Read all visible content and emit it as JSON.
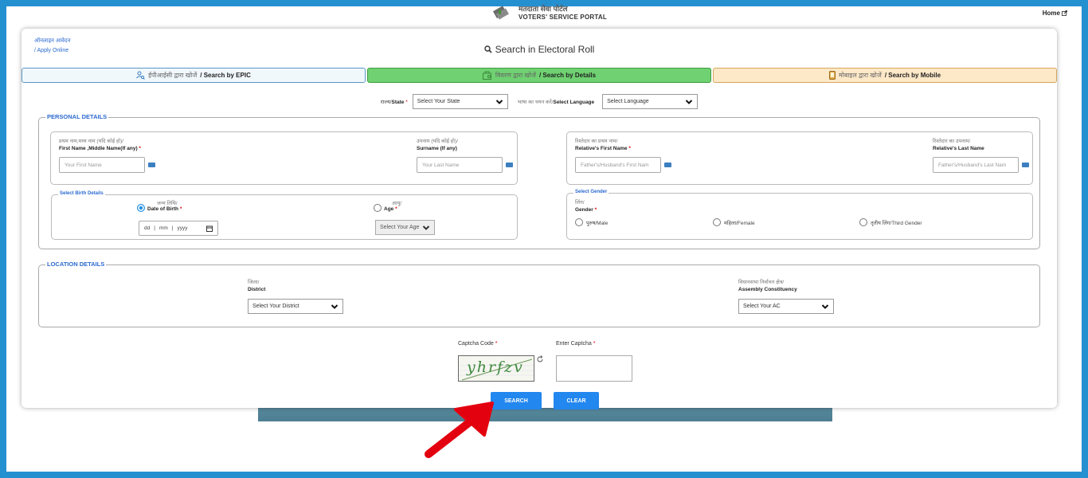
{
  "header": {
    "portal_name_hi": "मतदाता सेवा पोर्टल",
    "portal_name_en": "VOTERS' SERVICE PORTAL",
    "home_label": "Home"
  },
  "card": {
    "apply_online_hi": "ऑनलाइन आवेदन",
    "apply_online_en": "/ Apply Online",
    "title": "Search in Electoral Roll"
  },
  "tabs": [
    {
      "hi": "ईपीआईसी द्वारा खोजें",
      "en": "/ Search by EPIC",
      "icon": "user-search-icon",
      "active": false
    },
    {
      "hi": "विवरण द्वारा खोजें",
      "en": "/ Search by Details",
      "icon": "details-icon",
      "active": true
    },
    {
      "hi": "मोबाइल द्वारा खोजें",
      "en": "/ Search by Mobile",
      "icon": "mobile-icon",
      "active": false
    }
  ],
  "state": {
    "label_hi": "राज्य/",
    "label_en": "State",
    "value": "Select Your State"
  },
  "language": {
    "label_hi": "भाषा का चयन करें/",
    "label_en": "Select Language",
    "value": "Select Language"
  },
  "personal": {
    "legend": "PERSONAL DETAILS",
    "first_name": {
      "label_hi": "प्रथम नाम,मध्य नाम (यदि कोई हो)/",
      "label_en": "First Name ,Middle Name(If any)",
      "placeholder": "Your First Name"
    },
    "surname": {
      "label_hi": "उपनाम (यदि कोई हो)/",
      "label_en": "Surname (If any)",
      "placeholder": "Your Last Name"
    },
    "relative_first": {
      "label_hi": "रिश्तेदार का प्रथम नाम/",
      "label_en": "Relative's First Name",
      "placeholder": "Father's/Husband's First Nam"
    },
    "relative_last": {
      "label_hi": "रिश्तेदार का उपनाम/",
      "label_en": "Relative's Last Name",
      "placeholder": "Father's/Husband's Last Nam"
    },
    "birth": {
      "legend": "Select Birth Details",
      "dob_hi": "जन्म तिथि/",
      "dob_en": "Date of Birth",
      "dob_placeholder": {
        "dd": "dd",
        "mm": "mm",
        "yyyy": "yyyy"
      },
      "age_hi": "आयु/",
      "age_en": "Age",
      "age_value": "Select Your Age",
      "selected": "dob"
    },
    "gender": {
      "legend": "Select Gender",
      "label_hi": "लिंग/",
      "label_en": "Gender",
      "options": [
        "पुरुष/Male",
        "महिला/Female",
        "तृतीय लिंग/Third Gender"
      ]
    }
  },
  "location": {
    "legend": "LOCATION DETAILS",
    "district": {
      "label_hi": "जिला/",
      "label_en": "District",
      "value": "Select Your District"
    },
    "ac": {
      "label_hi": "विधानसभा निर्वाचन क्षेत्र/",
      "label_en": "Assembly Constituency",
      "value": "Select Your AC"
    }
  },
  "captcha": {
    "code_label": "Captcha Code",
    "code_text": "yhrfzv",
    "enter_label": "Enter Captcha",
    "value": ""
  },
  "actions": {
    "search": "SEARCH",
    "clear": "CLEAR"
  },
  "colors": {
    "accent": "#2287ee",
    "border_blue": "#2590d0",
    "tab_active": "#6fd171",
    "tab_mobile": "#fde8c8",
    "annotation_arrow": "#e3000f"
  }
}
